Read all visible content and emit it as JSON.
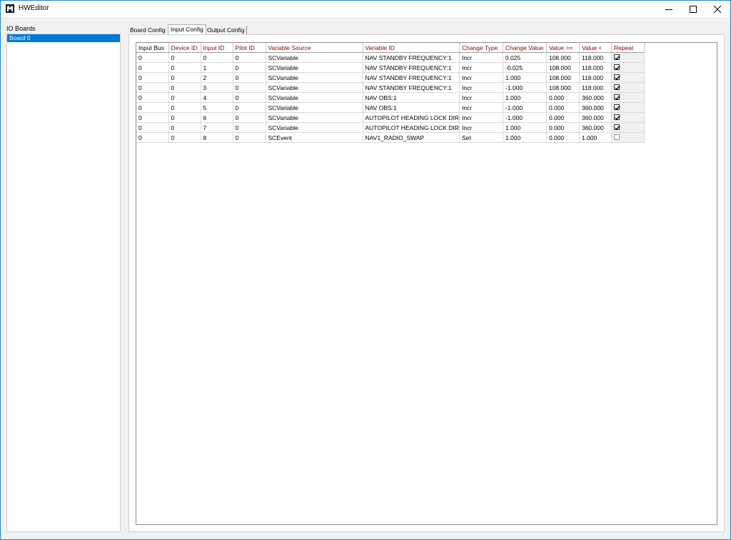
{
  "window": {
    "title": "HWEditor"
  },
  "left_panel": {
    "label": "IO Boards",
    "boards": [
      {
        "label": "Board 0",
        "selected": true
      }
    ]
  },
  "tabs": [
    {
      "label": "Board Config",
      "active": false
    },
    {
      "label": "Input Config",
      "active": true
    },
    {
      "label": "Output Config",
      "active": false
    }
  ],
  "table": {
    "columns": [
      "Input Bus",
      "Device ID",
      "Input ID",
      "Pilot ID",
      "Variable Source",
      "Variable ID",
      "Change Type",
      "Change Value",
      "Value >=",
      "Value <",
      "Repeat"
    ],
    "rows": [
      [
        "0",
        "0",
        "0",
        "0",
        "SCVariable",
        "NAV STANDBY FREQUENCY:1",
        "Incr",
        "0.025",
        "108.000",
        "118.000",
        true
      ],
      [
        "0",
        "0",
        "1",
        "0",
        "SCVariable",
        "NAV STANDBY FREQUENCY:1",
        "Incr",
        "-0.025",
        "108.000",
        "118.000",
        true
      ],
      [
        "0",
        "0",
        "2",
        "0",
        "SCVariable",
        "NAV STANDBY FREQUENCY:1",
        "Incr",
        "1.000",
        "108.000",
        "118.000",
        true
      ],
      [
        "0",
        "0",
        "3",
        "0",
        "SCVariable",
        "NAV STANDBY FREQUENCY:1",
        "Incr",
        "-1.000",
        "108.000",
        "118.000",
        true
      ],
      [
        "0",
        "0",
        "4",
        "0",
        "SCVariable",
        "NAV OBS:1",
        "Incr",
        "1.000",
        "0.000",
        "360.000",
        true
      ],
      [
        "0",
        "0",
        "5",
        "0",
        "SCVariable",
        "NAV OBS:1",
        "Incr",
        "-1.000",
        "0.000",
        "360.000",
        true
      ],
      [
        "0",
        "0",
        "6",
        "0",
        "SCVariable",
        "AUTOPILOT HEADING LOCK DIR",
        "Incr",
        "-1.000",
        "0.000",
        "360.000",
        true
      ],
      [
        "0",
        "0",
        "7",
        "0",
        "SCVariable",
        "AUTOPILOT HEADING LOCK DIR",
        "Incr",
        "1.000",
        "0.000",
        "360.000",
        true
      ],
      [
        "0",
        "0",
        "8",
        "0",
        "SCEvent",
        "NAV1_RADIO_SWAP",
        "Set",
        "1.000",
        "0.000",
        "1.000",
        false
      ]
    ]
  },
  "colors": {
    "accent": "#0078d7",
    "header_text": "#8b0000"
  }
}
